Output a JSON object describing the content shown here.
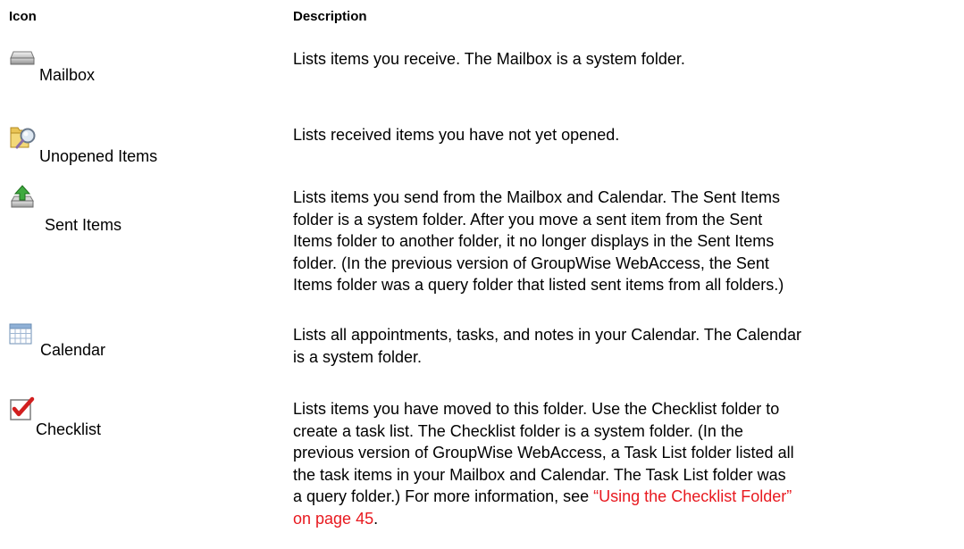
{
  "header": {
    "icon_col": "Icon",
    "desc_col": "Description"
  },
  "rows": [
    {
      "icon": "mailbox-tray-icon",
      "label": "Mailbox",
      "description": "Lists items you receive. The Mailbox is a system folder."
    },
    {
      "icon": "folder-magnifier-icon",
      "label": "Unopened Items",
      "description": "Lists received items you have not yet opened."
    },
    {
      "icon": "sent-tray-arrow-icon",
      "label": "Sent Items",
      "description_lines": [
        "Lists items you send from the Mailbox and Calendar. The Sent Items",
        "folder is a system folder. After you move a sent item from the Sent",
        "Items folder to another folder, it no longer displays in the Sent Items",
        "folder. (In the previous version of GroupWise WebAccess, the Sent",
        "Items folder was a query folder that listed sent items from all folders.)"
      ]
    },
    {
      "icon": "calendar-grid-icon",
      "label": "Calendar",
      "description_lines": [
        "Lists all appointments, tasks, and notes in your Calendar. The Calendar",
        "is a system folder."
      ]
    },
    {
      "icon": "checkmark-box-icon",
      "label": "Checklist",
      "description_lines": [
        "Lists items you have moved to this folder. Use the Checklist folder to",
        "create a task list. The Checklist folder is a system folder. (In the",
        "previous version of GroupWise WebAccess, a Task List folder listed all",
        "the task items in your Mailbox and Calendar. The Task List folder was",
        "a query folder.) For more information, see "
      ],
      "link_text_line1": "“Using the Checklist Folder”",
      "link_text_line2": "on page 45",
      "trailing_text": "."
    }
  ],
  "colors": {
    "link": "#e8191f",
    "text": "#000000"
  }
}
